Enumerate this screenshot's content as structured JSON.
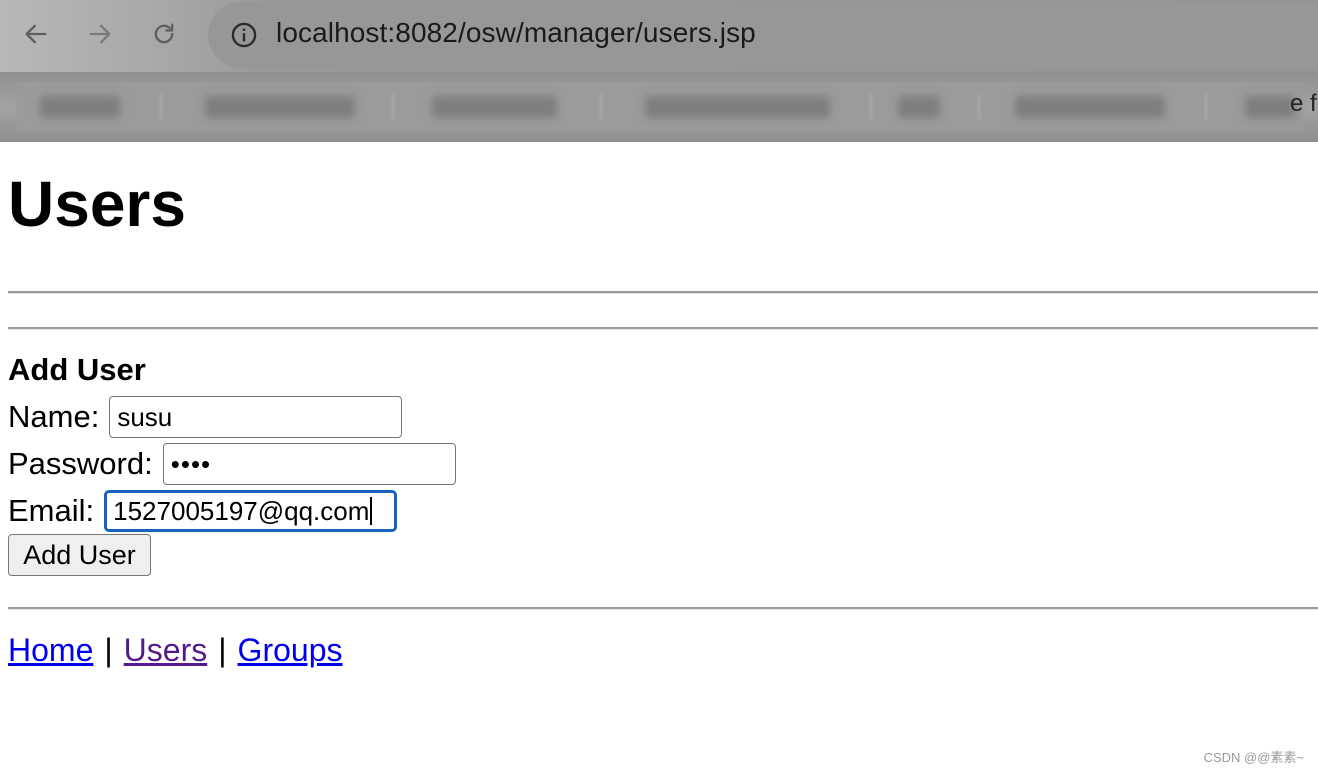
{
  "browser": {
    "url": "localhost:8082/osw/manager/users.jsp",
    "bookmarks_clipped_text": "e f"
  },
  "page": {
    "title": "Users",
    "add_user_heading": "Add User",
    "form": {
      "name_label": "Name:",
      "name_value": "susu",
      "password_label": "Password:",
      "password_value": "••••",
      "email_label": "Email:",
      "email_value": "1527005197@qq.com",
      "submit_label": "Add User"
    },
    "footer_links": [
      {
        "label": "Home",
        "state": "unvisited"
      },
      {
        "label": "Users",
        "state": "visited"
      },
      {
        "label": "Groups",
        "state": "unvisited"
      }
    ],
    "link_separator": "|"
  },
  "watermark": "CSDN @@素素~",
  "colors": {
    "link": "#0000ee",
    "visited_link": "#551a8b",
    "focus_ring": "#1565c0"
  }
}
